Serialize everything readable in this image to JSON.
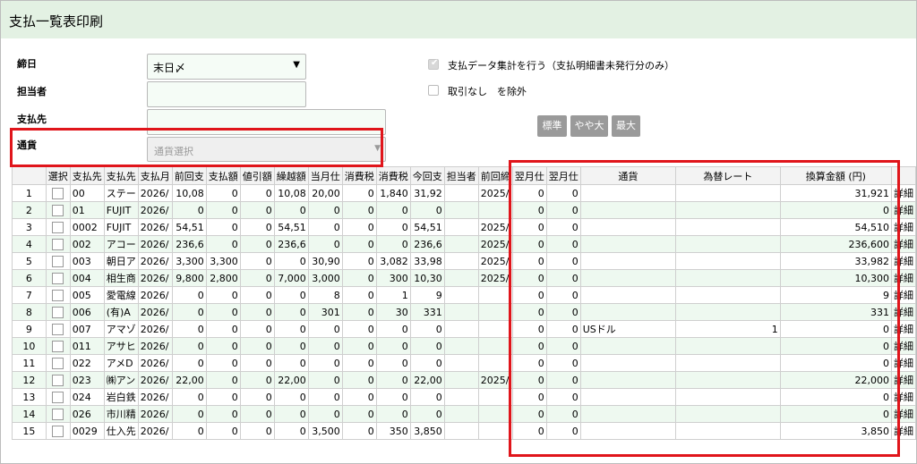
{
  "title": "支払一覧表印刷",
  "form": {
    "closing_label": "締日",
    "closing_value": "末日〆",
    "staff_label": "担当者",
    "staff_value": "",
    "payee_label": "支払先",
    "payee_value": "",
    "currency_label": "通貨",
    "currency_placeholder": "通貨選択"
  },
  "options": {
    "aggregate_label": "支払データ集計を行う（支払明細書未発行分のみ）",
    "exclude_label": "取引なし　を除外"
  },
  "zoom": {
    "standard": "標準",
    "large": "やや大",
    "max": "最大"
  },
  "table": {
    "headers": [
      "",
      "選択",
      "支払先",
      "支払先",
      "支払月",
      "前回支",
      "支払額",
      "値引額",
      "繰越額",
      "当月仕",
      "消費税",
      "消費税",
      "今回支",
      "担当者",
      "前回締",
      "翌月仕",
      "翌月仕",
      "通貨",
      "為替レート",
      "換算金額 (円)",
      ""
    ],
    "rows": [
      {
        "no": "1",
        "code": "00",
        "name": "ステー",
        "date": "2026/",
        "prev": "10,08",
        "paid": "0",
        "disc": "0",
        "carry": "10,08",
        "cur": "20,00",
        "tax1": "0",
        "tax2": "1,840",
        "now": "31,92",
        "staff": "",
        "pclose": "2025/",
        "n1": "0",
        "n2": "0",
        "currency": "",
        "rate": "",
        "conv": "31,921",
        "detail": "詳細"
      },
      {
        "no": "2",
        "code": "01",
        "name": "FUJIT",
        "date": "2026/",
        "prev": "0",
        "paid": "0",
        "disc": "0",
        "carry": "0",
        "cur": "0",
        "tax1": "0",
        "tax2": "0",
        "now": "0",
        "staff": "",
        "pclose": "",
        "n1": "0",
        "n2": "0",
        "currency": "",
        "rate": "",
        "conv": "0",
        "detail": "詳細"
      },
      {
        "no": "3",
        "code": "0002",
        "name": "FUJIT",
        "date": "2026/",
        "prev": "54,51",
        "paid": "0",
        "disc": "0",
        "carry": "54,51",
        "cur": "0",
        "tax1": "0",
        "tax2": "0",
        "now": "54,51",
        "staff": "",
        "pclose": "2025/",
        "n1": "0",
        "n2": "0",
        "currency": "",
        "rate": "",
        "conv": "54,510",
        "detail": "詳細"
      },
      {
        "no": "4",
        "code": "002",
        "name": "アコー",
        "date": "2026/",
        "prev": "236,6",
        "paid": "0",
        "disc": "0",
        "carry": "236,6",
        "cur": "0",
        "tax1": "0",
        "tax2": "0",
        "now": "236,6",
        "staff": "",
        "pclose": "2025/",
        "n1": "0",
        "n2": "0",
        "currency": "",
        "rate": "",
        "conv": "236,600",
        "detail": "詳細"
      },
      {
        "no": "5",
        "code": "003",
        "name": "朝日ア",
        "date": "2026/",
        "prev": "3,300",
        "paid": "3,300",
        "disc": "0",
        "carry": "0",
        "cur": "30,90",
        "tax1": "0",
        "tax2": "3,082",
        "now": "33,98",
        "staff": "",
        "pclose": "2025/",
        "n1": "0",
        "n2": "0",
        "currency": "",
        "rate": "",
        "conv": "33,982",
        "detail": "詳細"
      },
      {
        "no": "6",
        "code": "004",
        "name": "相生商",
        "date": "2026/",
        "prev": "9,800",
        "paid": "2,800",
        "disc": "0",
        "carry": "7,000",
        "cur": "3,000",
        "tax1": "0",
        "tax2": "300",
        "now": "10,30",
        "staff": "",
        "pclose": "2025/",
        "n1": "0",
        "n2": "0",
        "currency": "",
        "rate": "",
        "conv": "10,300",
        "detail": "詳細"
      },
      {
        "no": "7",
        "code": "005",
        "name": "愛電線",
        "date": "2026/",
        "prev": "0",
        "paid": "0",
        "disc": "0",
        "carry": "0",
        "cur": "8",
        "tax1": "0",
        "tax2": "1",
        "now": "9",
        "staff": "",
        "pclose": "",
        "n1": "0",
        "n2": "0",
        "currency": "",
        "rate": "",
        "conv": "9",
        "detail": "詳細"
      },
      {
        "no": "8",
        "code": "006",
        "name": "(有)A",
        "date": "2026/",
        "prev": "0",
        "paid": "0",
        "disc": "0",
        "carry": "0",
        "cur": "301",
        "tax1": "0",
        "tax2": "30",
        "now": "331",
        "staff": "",
        "pclose": "",
        "n1": "0",
        "n2": "0",
        "currency": "",
        "rate": "",
        "conv": "331",
        "detail": "詳細"
      },
      {
        "no": "9",
        "code": "007",
        "name": "アマゾ",
        "date": "2026/",
        "prev": "0",
        "paid": "0",
        "disc": "0",
        "carry": "0",
        "cur": "0",
        "tax1": "0",
        "tax2": "0",
        "now": "0",
        "staff": "",
        "pclose": "",
        "n1": "0",
        "n2": "0",
        "currency": "USドル",
        "rate": "1",
        "conv": "0",
        "detail": "詳細"
      },
      {
        "no": "10",
        "code": "011",
        "name": "アサヒ",
        "date": "2026/",
        "prev": "0",
        "paid": "0",
        "disc": "0",
        "carry": "0",
        "cur": "0",
        "tax1": "0",
        "tax2": "0",
        "now": "0",
        "staff": "",
        "pclose": "",
        "n1": "0",
        "n2": "0",
        "currency": "",
        "rate": "",
        "conv": "0",
        "detail": "詳細"
      },
      {
        "no": "11",
        "code": "022",
        "name": "アメD",
        "date": "2026/",
        "prev": "0",
        "paid": "0",
        "disc": "0",
        "carry": "0",
        "cur": "0",
        "tax1": "0",
        "tax2": "0",
        "now": "0",
        "staff": "",
        "pclose": "",
        "n1": "0",
        "n2": "0",
        "currency": "",
        "rate": "",
        "conv": "0",
        "detail": "詳細"
      },
      {
        "no": "12",
        "code": "023",
        "name": "㈱アン",
        "date": "2026/",
        "prev": "22,00",
        "paid": "0",
        "disc": "0",
        "carry": "22,00",
        "cur": "0",
        "tax1": "0",
        "tax2": "0",
        "now": "22,00",
        "staff": "",
        "pclose": "2025/",
        "n1": "0",
        "n2": "0",
        "currency": "",
        "rate": "",
        "conv": "22,000",
        "detail": "詳細"
      },
      {
        "no": "13",
        "code": "024",
        "name": "岩白鉄",
        "date": "2026/",
        "prev": "0",
        "paid": "0",
        "disc": "0",
        "carry": "0",
        "cur": "0",
        "tax1": "0",
        "tax2": "0",
        "now": "0",
        "staff": "",
        "pclose": "",
        "n1": "0",
        "n2": "0",
        "currency": "",
        "rate": "",
        "conv": "0",
        "detail": "詳細"
      },
      {
        "no": "14",
        "code": "026",
        "name": "市川精",
        "date": "2026/",
        "prev": "0",
        "paid": "0",
        "disc": "0",
        "carry": "0",
        "cur": "0",
        "tax1": "0",
        "tax2": "0",
        "now": "0",
        "staff": "",
        "pclose": "",
        "n1": "0",
        "n2": "0",
        "currency": "",
        "rate": "",
        "conv": "0",
        "detail": "詳細"
      },
      {
        "no": "15",
        "code": "0029",
        "name": "仕入先",
        "date": "2026/",
        "prev": "0",
        "paid": "0",
        "disc": "0",
        "carry": "0",
        "cur": "3,500",
        "tax1": "0",
        "tax2": "350",
        "now": "3,850",
        "staff": "",
        "pclose": "",
        "n1": "0",
        "n2": "0",
        "currency": "",
        "rate": "",
        "conv": "3,850",
        "detail": "詳細"
      }
    ]
  },
  "colors": {
    "titlebar": "#e3f1e3",
    "highlight": "#e0151b",
    "row_alt": "#eef9f0"
  }
}
